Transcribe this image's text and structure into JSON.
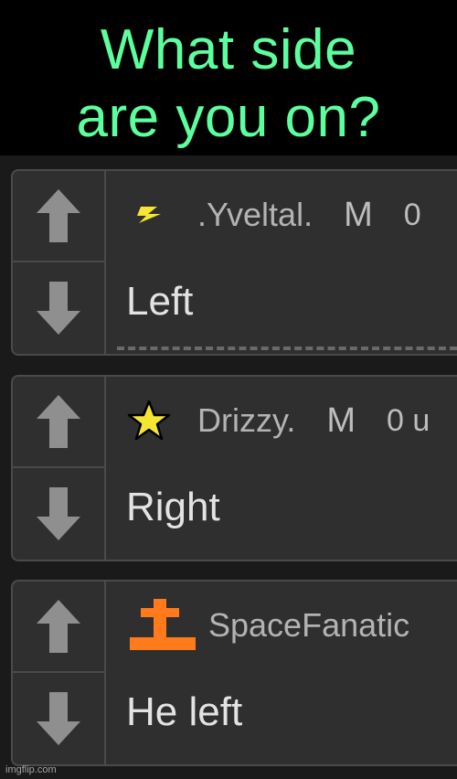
{
  "meme": {
    "headline_line1": "What side",
    "headline_line2": "are you on?"
  },
  "comments": [
    {
      "badge_icon": "lightning-bolt-icon",
      "username": ".Yveltal.",
      "gender": "M",
      "points": "0",
      "text": "Left"
    },
    {
      "badge_icon": "star-icon",
      "username": "Drizzy.",
      "gender": "M",
      "points": "0 u",
      "text": "Right"
    },
    {
      "badge_icon": "cross-icon",
      "username": "SpaceFanatic",
      "gender": "",
      "points": "",
      "text": "He left"
    }
  ],
  "watermark": "imgflip.com",
  "colors": {
    "headline": "#5cff9e",
    "card_bg": "#2f2f2f",
    "badge_star": "#f5e632",
    "badge_cross": "#ff7a1a"
  }
}
